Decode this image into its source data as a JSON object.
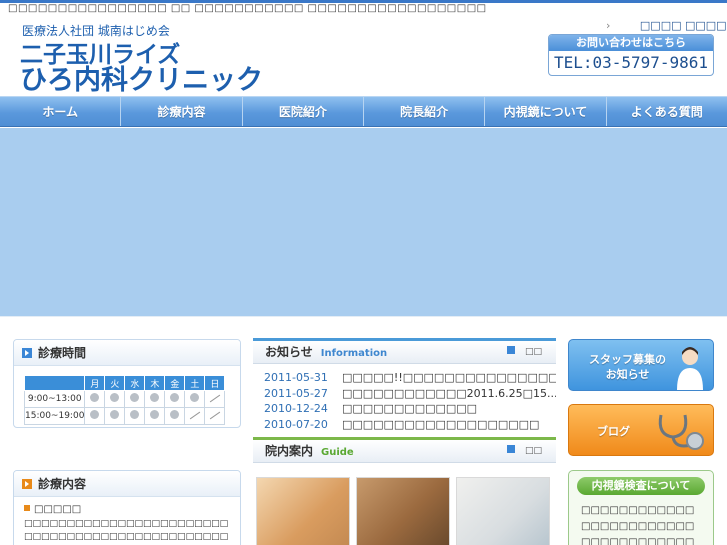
{
  "header": {
    "tagline": "□□□□□□□□□□□□□□□□ □□ □□□□□□□□□□□ □□□□□□□□□□□□□□□□□□",
    "corp_name": "医療法人社団 城南はじめ会",
    "clinic_line1": "二子玉川ライズ",
    "clinic_line2": "ひろ内科クリニック",
    "links": [
      "□□□□",
      "□□□□□□"
    ],
    "contact_label": "お問い合わせはこちら",
    "tel": "TEL:03-5797-9861"
  },
  "nav": {
    "items": [
      "ホーム",
      "診療内容",
      "医院紹介",
      "院長紹介",
      "内視鏡について",
      "よくある質問"
    ]
  },
  "hours": {
    "title": "診療時間",
    "days": [
      "月",
      "火",
      "水",
      "木",
      "金",
      "土",
      "日"
    ],
    "rows": [
      {
        "time": "9:00~13:00",
        "marks": [
          "open",
          "open",
          "open",
          "open",
          "open",
          "open",
          "closed"
        ]
      },
      {
        "time": "15:00~19:00",
        "marks": [
          "open",
          "open",
          "open",
          "open",
          "open",
          "closed",
          "closed"
        ]
      }
    ],
    "note_highlight": "□□",
    "note_rest": "□□□□□□□□"
  },
  "services": {
    "title": "診療内容",
    "item_title": "□□□□□",
    "item_text": "□□□□□□□□□□□□□□□□□□□□□□□□□□□□□□□□□□□□□□□□□□□□□□□□□□□□□□□□□□□□□□□□□□□□□□□□"
  },
  "news": {
    "title": "お知らせ",
    "subtitle": "Information",
    "controls": "□□",
    "items": [
      {
        "date": "2011-05-31",
        "text": "□□□□□!!□□□□□□□□□□□□□□□□□□□□"
      },
      {
        "date": "2011-05-27",
        "text": "□□□□□□□□□□□□2011.6.25□15..."
      },
      {
        "date": "2010-12-24",
        "text": "□□□□□□□□□□□□□"
      },
      {
        "date": "2010-07-20",
        "text": "□□□□□□□□□□□□□□□□□□□"
      }
    ]
  },
  "guide": {
    "title": "院内案内",
    "subtitle": "Guide",
    "controls": "□□"
  },
  "banners": {
    "staff": [
      "スタッフ募集の",
      "お知らせ"
    ],
    "blog": "ブログ",
    "endoscope_title": "内視鏡検査について",
    "endoscope_lines": [
      "□□□□□□□□□□□□",
      "□□□□□□□□□□□□",
      "□□□□□□□□□□□□"
    ]
  },
  "colors": {
    "brand_blue": "#1d5fae",
    "nav_blue": "#5a98dc",
    "hero": "#a9cdef",
    "orange": "#f08a1a",
    "green": "#5aa832"
  }
}
